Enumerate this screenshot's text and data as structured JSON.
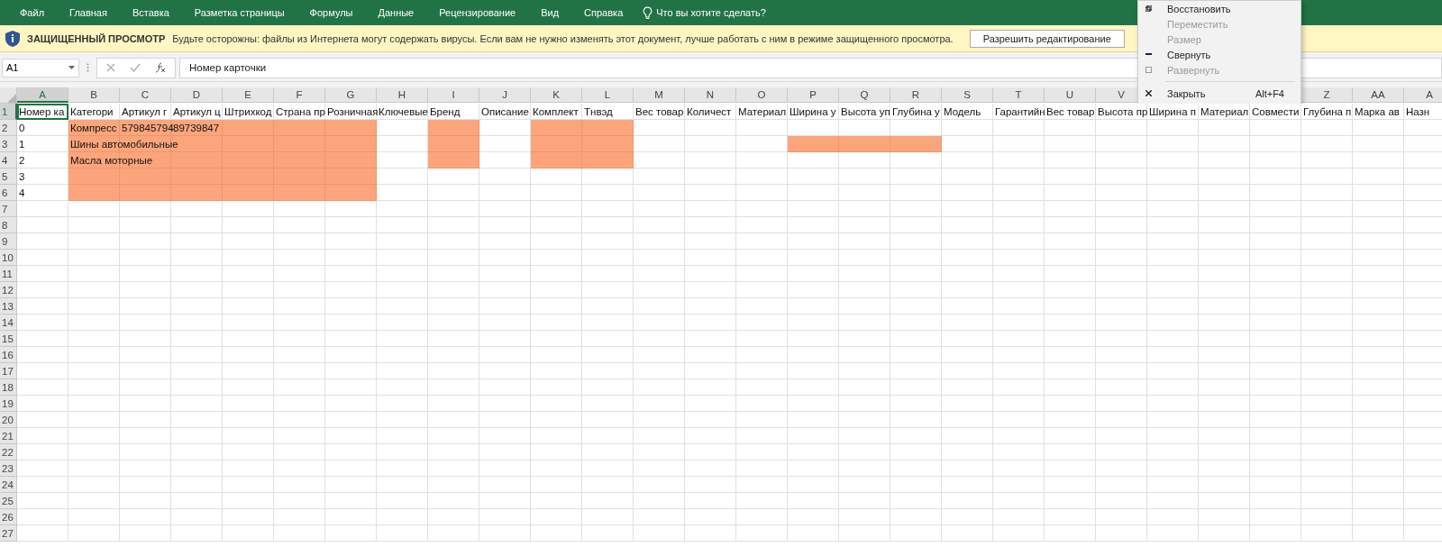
{
  "menu_tabs": [
    {
      "label": "Файл"
    },
    {
      "label": "Главная"
    },
    {
      "label": "Вставка"
    },
    {
      "label": "Разметка страницы"
    },
    {
      "label": "Формулы"
    },
    {
      "label": "Данные"
    },
    {
      "label": "Рецензирование"
    },
    {
      "label": "Вид"
    },
    {
      "label": "Справка"
    }
  ],
  "tell_me": {
    "placeholder": "Что вы хотите сделать?"
  },
  "protected_view": {
    "title": "ЗАЩИЩЕННЫЙ ПРОСМОТР",
    "message": "Будьте осторожны: файлы из Интернета могут содержать вирусы. Если вам не нужно изменять этот документ, лучше работать с ним в режиме защищенного просмотра.",
    "button": "Разрешить редактирование"
  },
  "formula_bar": {
    "name_box": "A1",
    "value": "Номер карточки"
  },
  "columns": [
    {
      "label": "A",
      "selected": true
    },
    {
      "label": "B",
      "selected": false
    },
    {
      "label": "C",
      "selected": false
    },
    {
      "label": "D",
      "selected": false
    },
    {
      "label": "E",
      "selected": false
    },
    {
      "label": "F",
      "selected": false
    },
    {
      "label": "G",
      "selected": false
    },
    {
      "label": "H",
      "selected": false
    },
    {
      "label": "I",
      "selected": false
    },
    {
      "label": "J",
      "selected": false
    },
    {
      "label": "K",
      "selected": false
    },
    {
      "label": "L",
      "selected": false
    },
    {
      "label": "M",
      "selected": false
    },
    {
      "label": "N",
      "selected": false
    },
    {
      "label": "O",
      "selected": false
    },
    {
      "label": "P",
      "selected": false
    },
    {
      "label": "Q",
      "selected": false
    },
    {
      "label": "R",
      "selected": false
    },
    {
      "label": "S",
      "selected": false
    },
    {
      "label": "T",
      "selected": false
    },
    {
      "label": "U",
      "selected": false
    },
    {
      "label": "V",
      "selected": false
    },
    null,
    null,
    null,
    {
      "label": "Z",
      "selected": false
    },
    {
      "label": "AA",
      "selected": false
    },
    {
      "label": "A",
      "selected": false
    }
  ],
  "rows": [
    {
      "number": "1",
      "selected": true,
      "cells": [
        {
          "text": "Номер ка",
          "filled": false
        },
        {
          "text": "Категори",
          "filled": false
        },
        {
          "text": "Артикул г",
          "filled": false
        },
        {
          "text": "Артикул ц",
          "filled": false
        },
        {
          "text": "Штрихкод",
          "filled": false
        },
        {
          "text": "Страна пр",
          "filled": false
        },
        {
          "text": "Розничная",
          "filled": false
        },
        {
          "text": "Ключевые",
          "filled": false
        },
        {
          "text": "Бренд",
          "filled": false
        },
        {
          "text": "Описание",
          "filled": false
        },
        {
          "text": "Комплект",
          "filled": false
        },
        {
          "text": "Тнвэд",
          "filled": false
        },
        {
          "text": "Вес товар",
          "filled": false
        },
        {
          "text": "Количест",
          "filled": false
        },
        {
          "text": "Материал",
          "filled": false
        },
        {
          "text": "Ширина у",
          "filled": false
        },
        {
          "text": "Высота уп",
          "filled": false
        },
        {
          "text": "Глубина у",
          "filled": false
        },
        {
          "text": "Модель",
          "filled": false
        },
        {
          "text": "Гарантийн",
          "filled": false
        },
        {
          "text": "Вес товар",
          "filled": false
        },
        {
          "text": "Высота пр",
          "filled": false
        },
        {
          "text": "Ширина п",
          "filled": false
        },
        {
          "text": "Материал",
          "filled": false
        },
        {
          "text": "Совмести",
          "filled": false
        },
        {
          "text": "Глубина п",
          "filled": false
        },
        {
          "text": "Марка ав",
          "filled": false
        },
        {
          "text": "Назн",
          "filled": false
        }
      ]
    },
    {
      "number": "2",
      "selected": false,
      "cells": [
        {
          "text": "0",
          "filled": false
        },
        {
          "text": "Компресс",
          "filled": true
        },
        {
          "text": "579845794",
          "filled": true
        },
        {
          "text": "89739847",
          "filled": true
        },
        {
          "filled": true
        },
        {
          "filled": true
        },
        {
          "filled": true
        },
        {
          "filled": false
        },
        {
          "filled": true
        },
        {
          "filled": false
        },
        {
          "filled": true
        },
        {
          "filled": true
        }
      ]
    },
    {
      "number": "3",
      "selected": false,
      "cells": [
        {
          "text": "1",
          "filled": false
        },
        {
          "text": "Шины автомобильные",
          "filled": true
        },
        {
          "filled": true
        },
        {
          "filled": true
        },
        {
          "filled": true
        },
        {
          "filled": true
        },
        {
          "filled": true
        },
        {
          "filled": false
        },
        {
          "filled": true
        },
        {
          "filled": false
        },
        {
          "filled": true
        },
        {
          "filled": true
        },
        {
          "filled": false
        },
        {
          "filled": false
        },
        {
          "filled": false
        },
        {
          "filled": true
        },
        {
          "filled": true
        },
        {
          "filled": true
        }
      ]
    },
    {
      "number": "4",
      "selected": false,
      "cells": [
        {
          "text": "2",
          "filled": false
        },
        {
          "text": "Масла моторные",
          "filled": true
        },
        {
          "filled": true
        },
        {
          "filled": true
        },
        {
          "filled": true
        },
        {
          "filled": true
        },
        {
          "filled": true
        },
        {
          "filled": false
        },
        {
          "filled": true
        },
        {
          "filled": false
        },
        {
          "filled": true
        },
        {
          "filled": true
        }
      ]
    },
    {
      "number": "5",
      "selected": false,
      "cells": [
        {
          "text": "3",
          "filled": false
        },
        {
          "filled": true
        },
        {
          "filled": true
        },
        {
          "filled": true
        },
        {
          "filled": true
        },
        {
          "filled": true
        },
        {
          "filled": true
        }
      ]
    },
    {
      "number": "6",
      "selected": false,
      "cells": [
        {
          "text": "4",
          "filled": false
        },
        {
          "filled": true
        },
        {
          "filled": true
        },
        {
          "filled": true
        },
        {
          "filled": true
        },
        {
          "filled": true
        },
        {
          "filled": true
        }
      ]
    },
    {
      "number": "7",
      "selected": false
    },
    {
      "number": "8",
      "selected": false
    },
    {
      "number": "9",
      "selected": false
    },
    {
      "number": "10",
      "selected": false
    },
    {
      "number": "11",
      "selected": false
    },
    {
      "number": "12",
      "selected": false
    },
    {
      "number": "13",
      "selected": false
    },
    {
      "number": "14",
      "selected": false
    },
    {
      "number": "15",
      "selected": false
    },
    {
      "number": "16",
      "selected": false
    },
    {
      "number": "17",
      "selected": false
    },
    {
      "number": "18",
      "selected": false
    },
    {
      "number": "19",
      "selected": false
    },
    {
      "number": "20",
      "selected": false
    },
    {
      "number": "21",
      "selected": false
    },
    {
      "number": "22",
      "selected": false
    },
    {
      "number": "23",
      "selected": false
    },
    {
      "number": "24",
      "selected": false
    },
    {
      "number": "25",
      "selected": false
    },
    {
      "number": "26",
      "selected": false
    },
    {
      "number": "27",
      "selected": false
    }
  ],
  "window_menu": [
    {
      "label": "Восстановить",
      "kind": "restore",
      "disabled": false
    },
    {
      "label": "Переместить",
      "kind": "plain",
      "disabled": true
    },
    {
      "label": "Размер",
      "kind": "plain",
      "disabled": true
    },
    {
      "label": "Свернуть",
      "kind": "minimize",
      "disabled": false
    },
    {
      "label": "Развернуть",
      "kind": "maximize",
      "disabled": true
    },
    {
      "kind": "separator"
    },
    {
      "label": "Закрыть",
      "kind": "close",
      "disabled": false,
      "shortcut": "Alt+F4"
    }
  ]
}
